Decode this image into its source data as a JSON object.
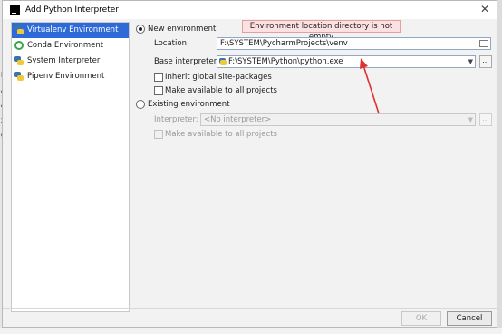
{
  "window": {
    "title": "Add Python Interpreter",
    "close_glyph": "✕"
  },
  "sidebar": {
    "items": [
      {
        "label": "Virtualenv Environment",
        "icon": "virtualenv-icon",
        "selected": true
      },
      {
        "label": "Conda Environment",
        "icon": "conda-icon",
        "selected": false
      },
      {
        "label": "System Interpreter",
        "icon": "python-icon",
        "selected": false
      },
      {
        "label": "Pipenv Environment",
        "icon": "pipenv-icon",
        "selected": false
      }
    ]
  },
  "new_env": {
    "radio_label": "New environment",
    "location_label": "Location:",
    "location_value": "F:\\SYSTEM\\PycharmProjects\\venv",
    "base_label": "Base interpreter:",
    "base_value": "F:\\SYSTEM\\Python\\python.exe",
    "inherit_label": "Inherit global site-packages",
    "make_available_label": "Make available to all projects",
    "error_tooltip": "Environment location directory is not empty"
  },
  "existing_env": {
    "radio_label": "Existing environment",
    "interpreter_label": "Interpreter:",
    "interpreter_value": "<No interpreter>",
    "make_available_label": "Make available to all projects"
  },
  "buttons": {
    "browse": "...",
    "ok": "OK",
    "cancel": "Cancel"
  },
  "colors": {
    "selection": "#2f6ad9",
    "tooltip_bg": "#fde0e0",
    "arrow": "#e03030"
  },
  "background_left_letters": [
    "F",
    "c",
    "ct",
    "x",
    "g"
  ]
}
